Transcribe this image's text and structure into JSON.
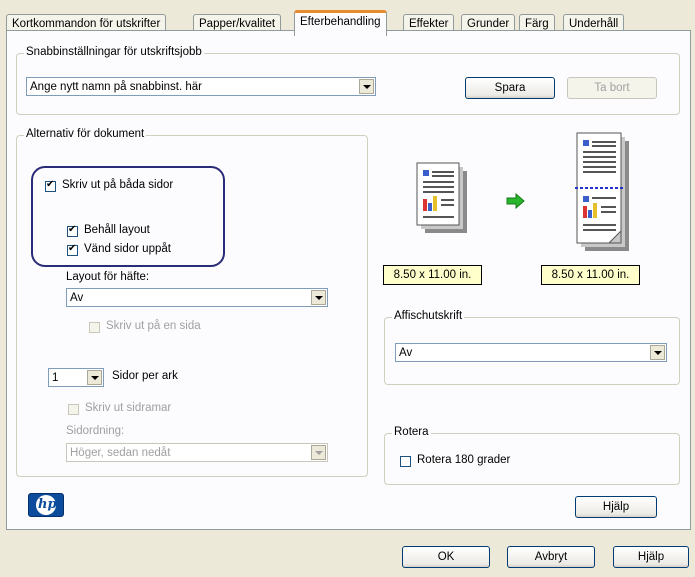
{
  "tabs": [
    {
      "label": "Kortkommandon för utskrifter",
      "active": false
    },
    {
      "label": "Papper/kvalitet",
      "active": false
    },
    {
      "label": "Efterbehandling",
      "active": true
    },
    {
      "label": "Effekter",
      "active": false
    },
    {
      "label": "Grunder",
      "active": false
    },
    {
      "label": "Färg",
      "active": false
    },
    {
      "label": "Underhåll",
      "active": false
    }
  ],
  "quick_settings": {
    "legend": "Snabbinställningar för utskriftsjobb",
    "name_value": "Ange nytt namn på snabbinst. här",
    "save_label": "Spara",
    "delete_label": "Ta bort"
  },
  "document_options": {
    "legend": "Alternativ för dokument",
    "duplex_label": "Skriv ut på båda sidor",
    "duplex_checked": true,
    "keep_layout_label": "Behåll layout",
    "keep_layout_checked": true,
    "flip_pages_label": "Vänd sidor uppåt",
    "flip_pages_checked": true,
    "booklet_layout_label": "Layout för häfte:",
    "booklet_layout_value": "Av",
    "one_side_label": "Skriv ut på en sida",
    "pages_per_sheet_value": "1",
    "pages_per_sheet_label": "Sidor per ark",
    "page_borders_label": "Skriv ut sidramar",
    "page_order_label": "Sidordning:",
    "page_order_value": "Höger, sedan nedåt"
  },
  "preview": {
    "source_size": "8.50 x 11.00 in.",
    "output_size": "8.50 x 11.00 in."
  },
  "poster": {
    "legend": "Affischutskrift",
    "value": "Av"
  },
  "rotate": {
    "legend": "Rotera",
    "rotate_label": "Rotera 180 grader",
    "checked": false
  },
  "buttons": {
    "help_inner": "Hjälp",
    "ok": "OK",
    "cancel": "Avbryt",
    "help": "Hjälp"
  },
  "logo_text": "hp",
  "colors": {
    "tab_active_accent": "#e68b2c",
    "highlight_ring": "#2b2c78",
    "size_box": "#ffffcc",
    "hp_blue": "#0d4c9c"
  }
}
